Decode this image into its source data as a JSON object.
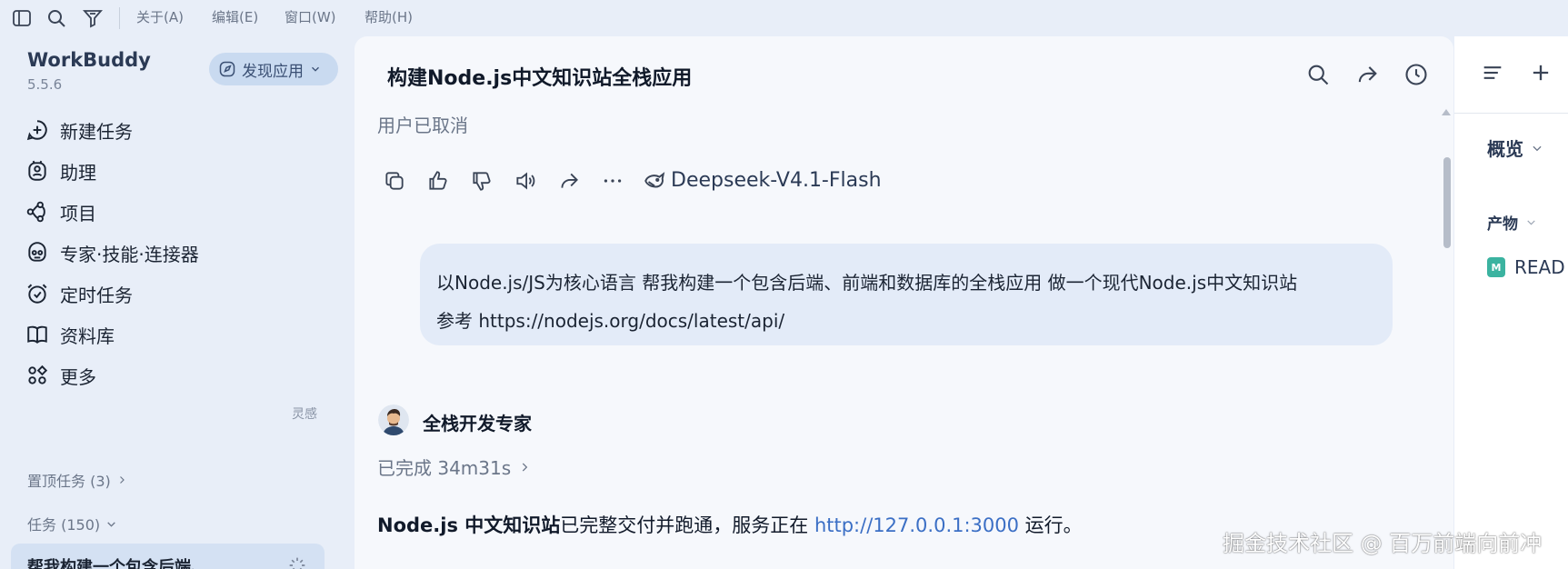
{
  "menu": {
    "items": [
      "关于(A)",
      "编辑(E)",
      "窗口(W)",
      "帮助(H)"
    ],
    "icons": [
      "sidebar-toggle-icon",
      "search-icon",
      "filter-icon"
    ]
  },
  "sidebar": {
    "brand": "WorkBuddy",
    "version": "5.5.6",
    "discover_label": "发现应用",
    "nav": [
      {
        "label": "新建任务",
        "icon": "new-task-icon"
      },
      {
        "label": "助理",
        "icon": "assistant-icon"
      },
      {
        "label": "项目",
        "icon": "project-icon"
      },
      {
        "label": "专家·技能·连接器",
        "icon": "experts-icon"
      },
      {
        "label": "定时任务",
        "icon": "alarm-icon"
      },
      {
        "label": "资料库",
        "icon": "library-icon"
      },
      {
        "label": "更多",
        "icon": "more-apps-icon",
        "tag": "灵感"
      }
    ],
    "pinned_label": "置顶任务 (3)",
    "tasks_label": "任务 (150)",
    "current_task": "帮我构建一个包含后端、"
  },
  "chat": {
    "title": "构建Node.js中文知识站全栈应用",
    "cancelled": "用户已取消",
    "model": "Deepseek-V4.1-Flash",
    "user_message_line1": "以Node.js/JS为核心语言 帮我构建一个包含后端、前端和数据库的全栈应用 做一个现代Node.js中文知识站",
    "user_message_line2": "参考 https://nodejs.org/docs/latest/api/",
    "agent_name": "全栈开发专家",
    "status": "已完成 34m31s",
    "result_bold": "Node.js 中文知识站",
    "result_mid": "已完整交付并跑通，服务正在 ",
    "result_link": "http://127.0.0.1:3000",
    "result_end": " 运行。"
  },
  "right_panel": {
    "overview_label": "概览",
    "artifacts_label": "产物",
    "file_name": "READ",
    "file_badge": "M"
  },
  "watermark": "掘金技术社区 @ 百万前端向前冲",
  "colors": {
    "accent": "#3b6fc5",
    "sidebar_bg": "#e8eef8",
    "bubble_bg": "#e3ebf8",
    "md_badge": "#3bb3a0"
  }
}
